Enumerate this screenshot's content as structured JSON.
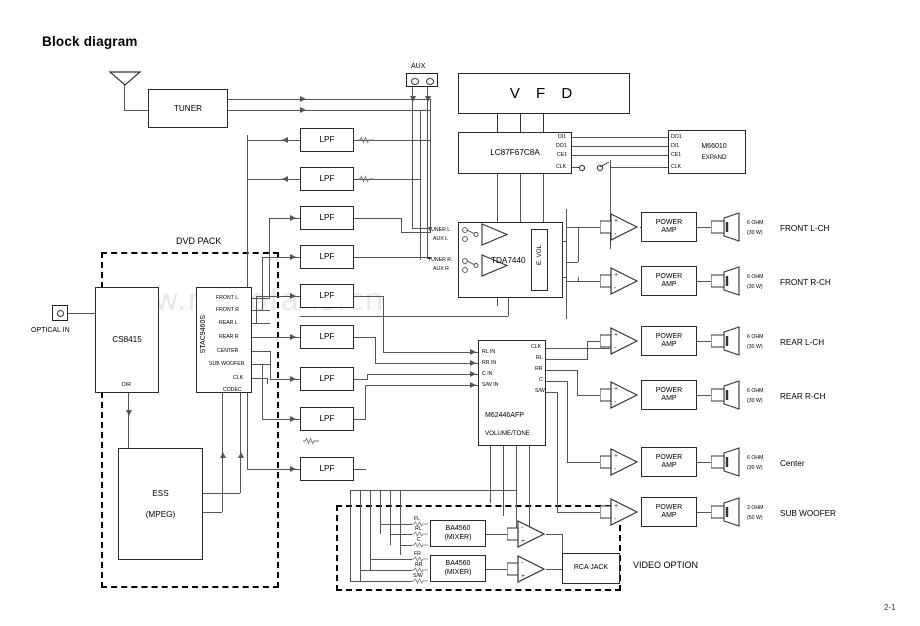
{
  "page": {
    "title": "Block diagram",
    "page_number": "2-1",
    "watermark": "www.radiofans.cn"
  },
  "inputs": {
    "aux_label": "AUX",
    "optical_label": "OPTICAL IN",
    "tuner_label": "TUNER"
  },
  "dvd_pack": {
    "group_label": "DVD PACK",
    "cs8415": "CS8415",
    "cs8415_pin": "DIR",
    "ess": "ESS",
    "ess_sub": "(MPEG)",
    "dac": "STAC9460S",
    "dac_pins": [
      "FRONT L",
      "FRONT R",
      "REAR L",
      "REAR R",
      "CENTER",
      "SUB WOOFER",
      "CLK"
    ],
    "dac_codec_pin": "CODEC"
  },
  "filters": {
    "label": "LPF",
    "count": 9
  },
  "display": {
    "vfd": "V F D",
    "mcu": "LC87F67C8A",
    "mcu_pins": [
      "DI1",
      "DO1",
      "CE1",
      "CLK"
    ],
    "expander": "M66010",
    "expander_sub": "EXPAND",
    "expander_pins": [
      "DO1",
      "DI1",
      "CE1",
      "CLK"
    ]
  },
  "front_processor": {
    "chip": "TDA7440",
    "evol": "E. VOL",
    "select_in": [
      "TUNER L",
      "AUX L",
      "TUNER R",
      "AUX R"
    ]
  },
  "surround_processor": {
    "chip": "M62446AFP",
    "chip_sub": "VOLUME/TONE",
    "inputs": [
      "RL IN",
      "RR IN",
      "C IN",
      "S/W IN"
    ],
    "outputs": [
      "CLK",
      "RL",
      "RR",
      "C",
      "S/W"
    ]
  },
  "power_amps": {
    "label_line1": "POWER",
    "label_line2": "AMP"
  },
  "speakers": [
    {
      "impedance": "6 OHM",
      "power": "(30 W)",
      "channel": "FRONT L-CH"
    },
    {
      "impedance": "6 OHM",
      "power": "(30 W)",
      "channel": "FRONT R-CH"
    },
    {
      "impedance": "6 OHM",
      "power": "(30 W)",
      "channel": "REAR L-CH"
    },
    {
      "impedance": "6 OHM",
      "power": "(30 W)",
      "channel": "REAR R-CH"
    },
    {
      "impedance": "6 OHM",
      "power": "(30 W)",
      "channel": "Center"
    },
    {
      "impedance": "3 OHM",
      "power": "(50 W)",
      "channel": "SUB WOOFER"
    }
  ],
  "video_option": {
    "group_label": "VIDEO OPTION",
    "mixer1": "BA4560",
    "mixer1_sub": "(MIXER)",
    "mixer2": "BA4560",
    "mixer2_sub": "(MIXER)",
    "mixer1_inputs": [
      "FL",
      "RL",
      "C"
    ],
    "mixer2_inputs": [
      "FR",
      "RR",
      "S/W"
    ],
    "rca": "RCA JACK"
  }
}
